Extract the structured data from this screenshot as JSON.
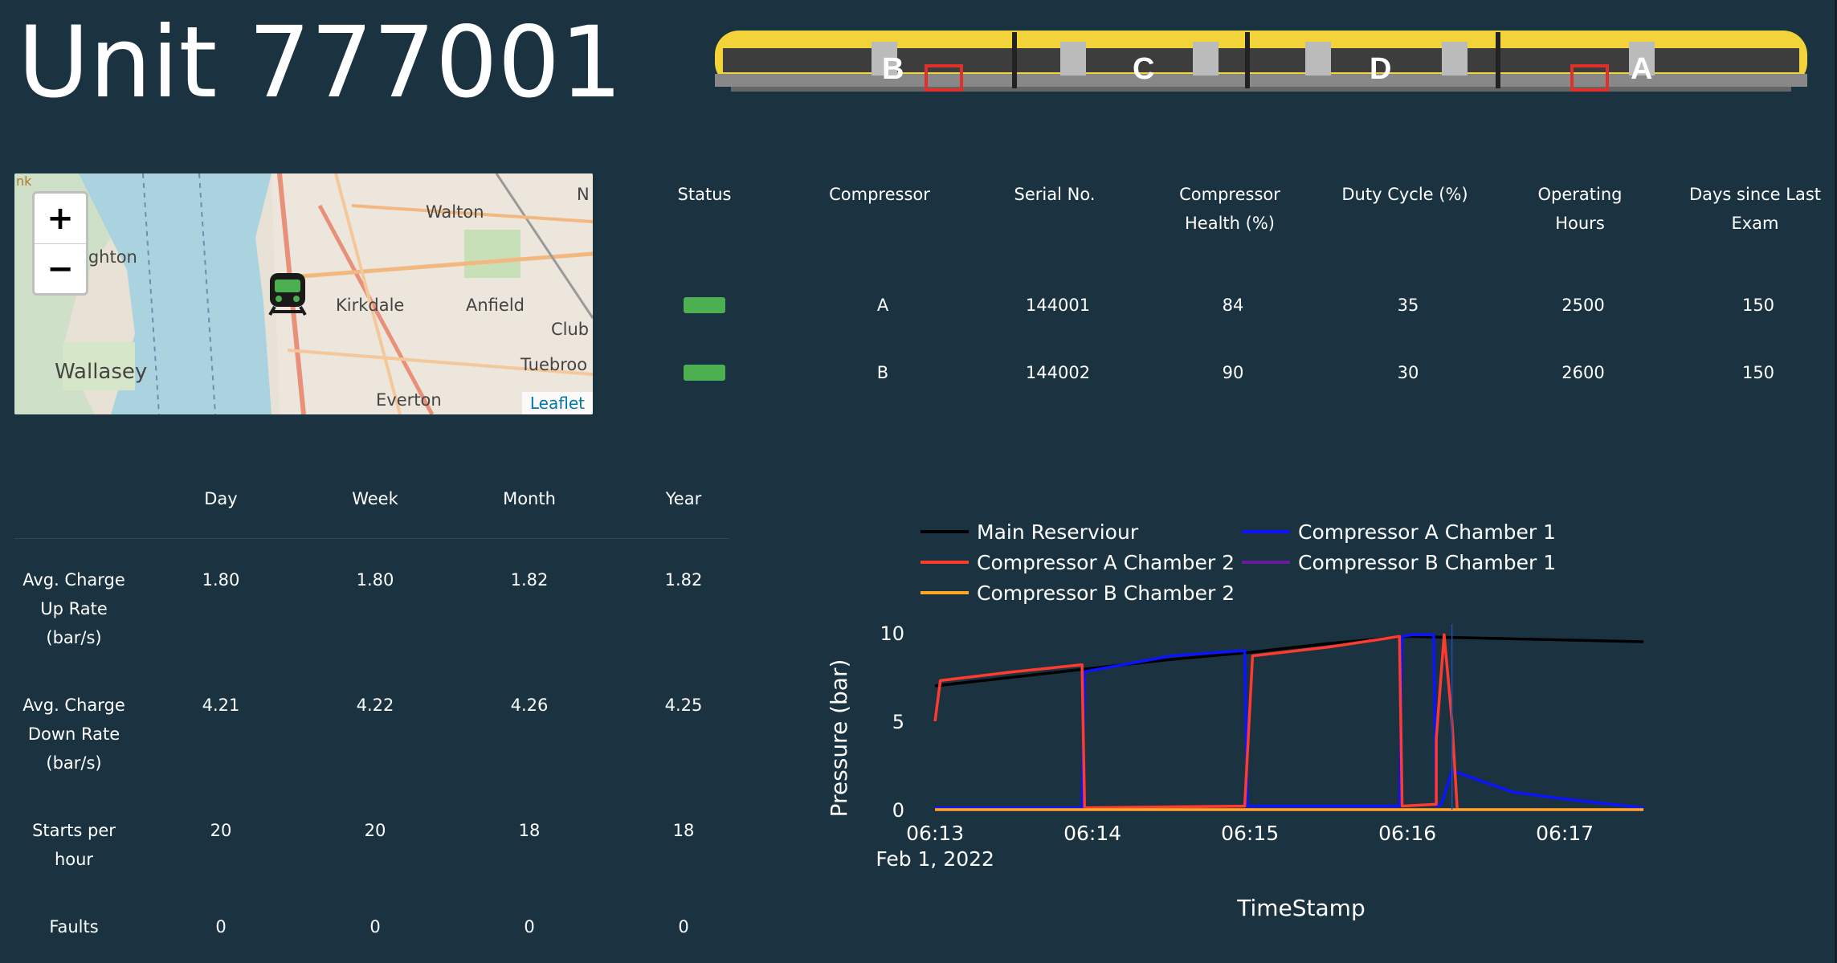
{
  "title": "Unit 777001",
  "train": {
    "car_labels": [
      "B",
      "C",
      "D",
      "A"
    ],
    "marker_color": "#e0302a"
  },
  "map": {
    "labels": [
      "nk",
      "Walton",
      "N",
      "ighton",
      "Kirkdale",
      "Anfield",
      "Club",
      "Wallasey",
      "Tuebroo",
      "Everton"
    ],
    "zoom_in": "+",
    "zoom_out": "−",
    "attribution": "Leaflet",
    "train_icon": "train-icon"
  },
  "compressor_table": {
    "headers": [
      "Status",
      "Compressor",
      "Serial No.",
      "Compressor\nHealth (%)",
      "Duty Cycle (%)",
      "Operating\nHours",
      "Days since Last\nExam"
    ],
    "rows": [
      {
        "status_color": "#4caf50",
        "compressor": "A",
        "serial": "144001",
        "health": "84",
        "duty": "35",
        "hours": "2500",
        "days": "150"
      },
      {
        "status_color": "#4caf50",
        "compressor": "B",
        "serial": "144002",
        "health": "90",
        "duty": "30",
        "hours": "2600",
        "days": "150"
      }
    ]
  },
  "stats_table": {
    "headers": [
      "",
      "Day",
      "Week",
      "Month",
      "Year"
    ],
    "rows": [
      {
        "label": "Avg. Charge\nUp Rate\n(bar/s)",
        "values": [
          "1.80",
          "1.80",
          "1.82",
          "1.82"
        ]
      },
      {
        "label": "Avg. Charge\nDown Rate\n(bar/s)",
        "values": [
          "4.21",
          "4.22",
          "4.26",
          "4.25"
        ]
      },
      {
        "label": "Starts per\nhour",
        "values": [
          "20",
          "20",
          "18",
          "18"
        ]
      },
      {
        "label": "Faults",
        "values": [
          "0",
          "0",
          "0",
          "0"
        ]
      }
    ]
  },
  "chart_data": {
    "type": "line",
    "xlabel": "TimeStamp",
    "ylabel": "Pressure (bar)",
    "x_ticks": [
      "06:13",
      "06:14",
      "06:15",
      "06:16",
      "06:17"
    ],
    "x_date_label": "Feb 1, 2022",
    "y_ticks": [
      "0",
      "5",
      "10"
    ],
    "ylim": [
      0,
      10.5
    ],
    "legend": "top",
    "series": [
      {
        "name": "Main Reserviour",
        "color": "#000000",
        "points": [
          [
            "06:13:00",
            7.0
          ],
          [
            "06:13:30",
            7.5
          ],
          [
            "06:14:00",
            8.0
          ],
          [
            "06:14:30",
            8.5
          ],
          [
            "06:15:00",
            8.9
          ],
          [
            "06:15:30",
            9.4
          ],
          [
            "06:16:00",
            9.8
          ],
          [
            "06:16:30",
            9.7
          ],
          [
            "06:17:00",
            9.6
          ],
          [
            "06:17:30",
            9.5
          ]
        ]
      },
      {
        "name": "Compressor A Chamber 1",
        "color": "#0a14ff",
        "points": [
          [
            "06:13:00",
            0.1
          ],
          [
            "06:13:56",
            0.1
          ],
          [
            "06:13:57",
            7.8
          ],
          [
            "06:14:30",
            8.7
          ],
          [
            "06:14:58",
            9.0
          ],
          [
            "06:14:59",
            0.2
          ],
          [
            "06:15:57",
            0.2
          ],
          [
            "06:15:58",
            9.8
          ],
          [
            "06:16:02",
            9.9
          ],
          [
            "06:16:10",
            9.9
          ],
          [
            "06:16:11",
            0.2
          ],
          [
            "06:16:13",
            0.3
          ],
          [
            "06:16:17",
            2.2
          ],
          [
            "06:16:40",
            1.0
          ],
          [
            "06:17:00",
            0.6
          ],
          [
            "06:17:30",
            0.1
          ]
        ]
      },
      {
        "name": "Compressor A Chamber 2",
        "color": "#ff3b2f",
        "points": [
          [
            "06:13:00",
            5.0
          ],
          [
            "06:13:02",
            7.3
          ],
          [
            "06:13:30",
            7.8
          ],
          [
            "06:13:56",
            8.2
          ],
          [
            "06:13:57",
            0.1
          ],
          [
            "06:14:58",
            0.2
          ],
          [
            "06:15:01",
            8.7
          ],
          [
            "06:15:30",
            9.2
          ],
          [
            "06:15:57",
            9.8
          ],
          [
            "06:15:58",
            0.2
          ],
          [
            "06:16:11",
            0.3
          ],
          [
            "06:16:11",
            4.0
          ],
          [
            "06:16:14",
            9.9
          ],
          [
            "06:16:17",
            5.0
          ],
          [
            "06:16:19",
            0.0
          ]
        ]
      },
      {
        "name": "Compressor B Chamber 1",
        "color": "#6a1b9a",
        "points": [
          [
            "06:13:00",
            0.0
          ],
          [
            "06:17:30",
            0.0
          ]
        ]
      },
      {
        "name": "Compressor B Chamber 2",
        "color": "#ffa726",
        "points": [
          [
            "06:13:00",
            0.0
          ],
          [
            "06:17:30",
            0.0
          ]
        ]
      }
    ],
    "cursor_time": "06:16:17"
  }
}
